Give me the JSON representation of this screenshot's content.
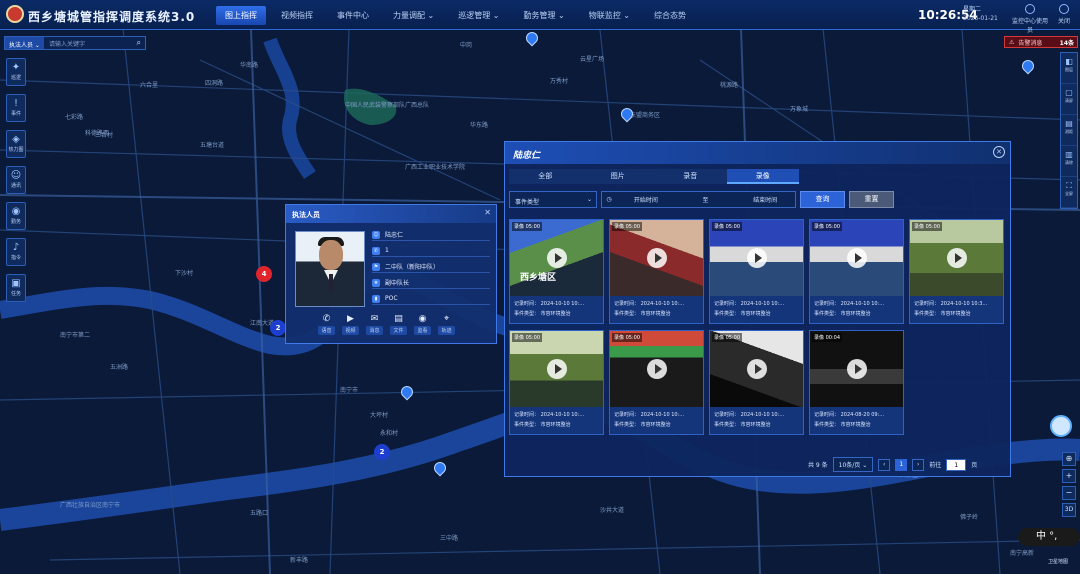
{
  "app": {
    "title": "西乡塘城管指挥调度系统3.0"
  },
  "nav": [
    {
      "label": "图上指挥"
    },
    {
      "label": "视频指挥"
    },
    {
      "label": "事件中心"
    },
    {
      "label": "力量调配 ⌄"
    },
    {
      "label": "巡逻管理 ⌄"
    },
    {
      "label": "勤务管理 ⌄"
    },
    {
      "label": "物联监控 ⌄"
    },
    {
      "label": "综合态势"
    }
  ],
  "header": {
    "time": "10:26:54",
    "weekday": "星期二",
    "date": "2025-01-21",
    "user": "监控中心使用员",
    "close": "关闭"
  },
  "search": {
    "type": "执法人员 ⌄",
    "placeholder": "请输入关键字"
  },
  "left_tools": [
    {
      "label": "巡逻",
      "icon": "patrol-icon"
    },
    {
      "label": "事件",
      "icon": "event-icon"
    },
    {
      "label": "热力图",
      "icon": "heatmap-icon"
    },
    {
      "label": "通讯",
      "icon": "contacts-icon"
    },
    {
      "label": "勤务",
      "icon": "duty-icon"
    },
    {
      "label": "指令",
      "icon": "bell-icon"
    },
    {
      "label": "任务",
      "icon": "task-icon"
    }
  ],
  "alarm": {
    "label": "告警消息",
    "count": "14条"
  },
  "right_tools": [
    {
      "label": "图层"
    },
    {
      "label": "清屏"
    },
    {
      "label": "测距"
    },
    {
      "label": "清除"
    },
    {
      "label": "全屏"
    }
  ],
  "zoom": {
    "locate": "⊕",
    "plus": "+",
    "minus": "−",
    "mode": "3D"
  },
  "ime": {
    "text": "中 °,",
    "label": "卫星地图"
  },
  "map": {
    "labels": [
      "三合村",
      "六合里",
      "四洞路",
      "七彩路",
      "科德路西",
      "五塘台道",
      "华南路",
      "中岗",
      "中国人民武装警察部队广西总队",
      "华东路",
      "万秀村",
      "云星广场",
      "东盟商务区",
      "桃源路",
      "万象城",
      "广西工业职业技术学院",
      "南宁市第二",
      "五洲路",
      "下沙村",
      "江南大道",
      "南宁市",
      "兴宁区",
      "广西壮族自治区南宁市",
      "大坪村",
      "永和村",
      "五路口",
      "佛子岭",
      "沙井大道",
      "新丰路",
      "三中路",
      "南宁高新"
    ],
    "cluster_red": "4",
    "cluster_blue1": "2",
    "cluster_blue2": "2"
  },
  "person_card": {
    "title": "执法人员",
    "name": "陆忠仁",
    "phone": "1",
    "team": "二中队（新阳中队）",
    "role": "副中队长",
    "device": "POC",
    "actions": [
      {
        "label": "语音",
        "icon": "phone-icon"
      },
      {
        "label": "视频",
        "icon": "video-call-icon"
      },
      {
        "label": "消息",
        "icon": "message-icon"
      },
      {
        "label": "文件",
        "icon": "file-icon"
      },
      {
        "label": "监看",
        "icon": "monitor-icon"
      },
      {
        "label": "轨迹",
        "icon": "track-icon"
      }
    ]
  },
  "media_panel": {
    "name": "陆忠仁",
    "tabs": [
      "全部",
      "图片",
      "录音",
      "录像"
    ],
    "active_tab": "录像",
    "event_type_placeholder": "事件类型",
    "start_placeholder": "开始时间",
    "range_sep": "至",
    "end_placeholder": "结束时间",
    "query": "查询",
    "reset": "重置",
    "videos": [
      {
        "tag": "录像 05:00",
        "time": "记录时间： 2024-10-10 10:...",
        "type": "事件类型： 市容环境整治",
        "overlay": "西乡塘区"
      },
      {
        "tag": "录像 05:00",
        "time": "记录时间： 2024-10-10 10:...",
        "type": "事件类型： 市容环境整治",
        "overlay": ""
      },
      {
        "tag": "录像 05:00",
        "time": "记录时间： 2024-10-10 10:...",
        "type": "事件类型： 市容环境整治",
        "overlay": ""
      },
      {
        "tag": "录像 05:00",
        "time": "记录时间： 2024-10-10 10:...",
        "type": "事件类型： 市容环境整治",
        "overlay": ""
      },
      {
        "tag": "录像 05:00",
        "time": "记录时间： 2024-10-10 10:3...",
        "type": "事件类型： 市容环境整治",
        "overlay": ""
      },
      {
        "tag": "录像 05:00",
        "time": "记录时间： 2024-10-10 10:...",
        "type": "事件类型： 市容环境整治",
        "overlay": ""
      },
      {
        "tag": "录像 05:00",
        "time": "记录时间： 2024-10-10 10:...",
        "type": "事件类型： 市容环境整治",
        "overlay": ""
      },
      {
        "tag": "录像 05:00",
        "time": "记录时间： 2024-10-10 10:...",
        "type": "事件类型： 市容环境整治",
        "overlay": ""
      },
      {
        "tag": "录像 00:04",
        "time": "记录时间： 2024-08-20 09:...",
        "type": "事件类型： 市容环境整治",
        "overlay": ""
      }
    ],
    "pagination": {
      "total": "共 9 条",
      "page_size": "10条/页 ⌄",
      "current": "1",
      "goto_label": "前往",
      "goto_value": "1",
      "page_unit": "页"
    }
  },
  "colors": {
    "accent": "#2c64d8",
    "alarm": "#d23a3a",
    "map_bg": "#0a1a38"
  }
}
